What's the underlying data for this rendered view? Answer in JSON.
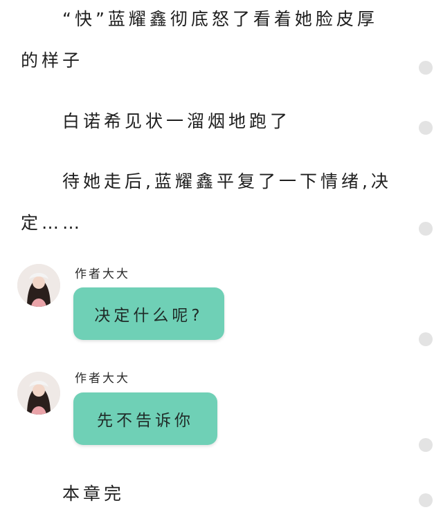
{
  "story": {
    "paragraph1": {
      "line1": "“快”蓝耀鑫彻底怒了看着她脸皮厚",
      "line2": "的样子"
    },
    "paragraph2": {
      "line1": "白诺希见状一溜烟地跑了"
    },
    "paragraph3": {
      "line1": "待她走后,蓝耀鑫平复了一下情绪,决",
      "line2": "定……"
    },
    "chapter_end": "本章完"
  },
  "chat": {
    "messages": [
      {
        "author": "作者大大",
        "text": "决定什么呢?"
      },
      {
        "author": "作者大大",
        "text": "先不告诉你"
      }
    ]
  },
  "colors": {
    "bubble": "#6fd0b6",
    "scroll_dot": "#e3e3e3",
    "text": "#1e1e1e"
  }
}
